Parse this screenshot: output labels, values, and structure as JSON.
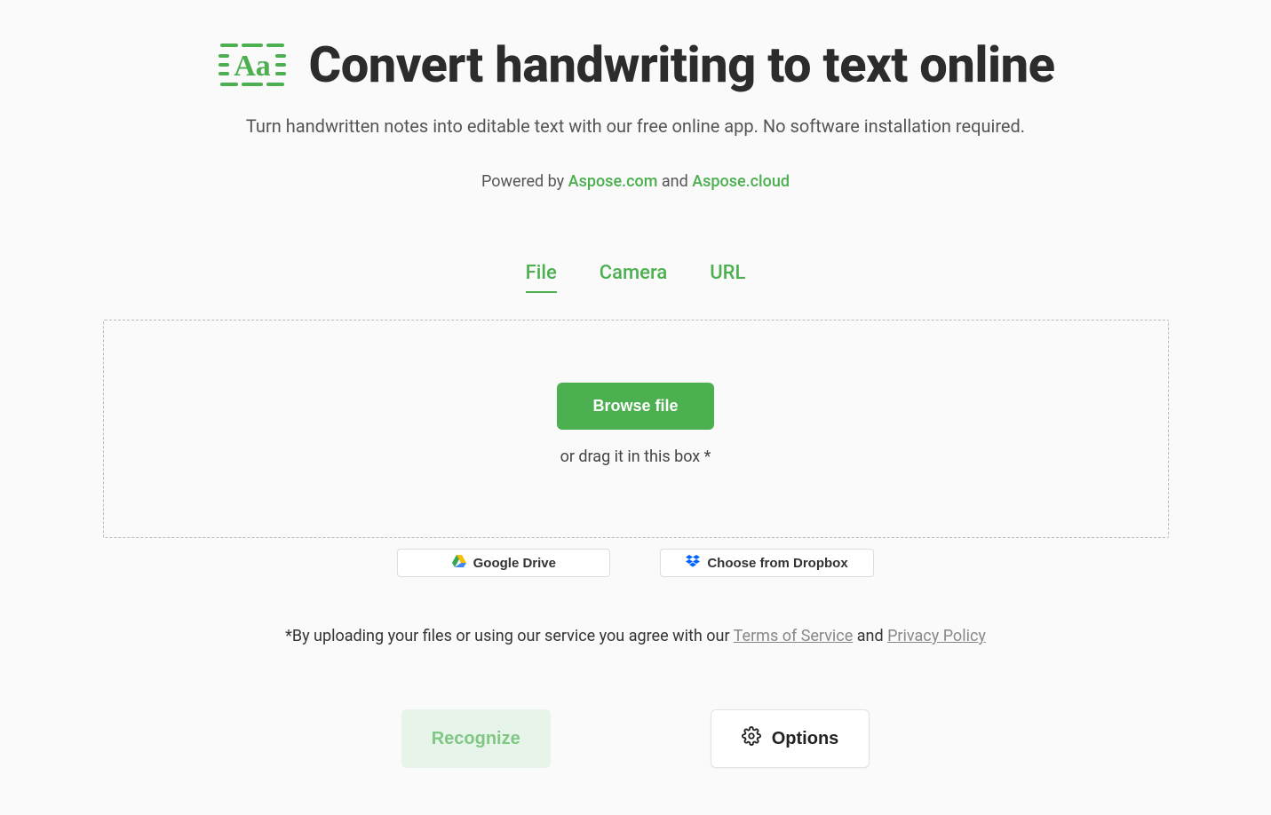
{
  "header": {
    "title": "Convert handwriting to text online",
    "subtitle": "Turn handwritten notes into editable text with our free online app. No software installation required.",
    "powered_prefix": "Powered by ",
    "powered_link1": "Aspose.com",
    "powered_and": " and ",
    "powered_link2": "Aspose.cloud"
  },
  "tabs": {
    "file": "File",
    "camera": "Camera",
    "url": "URL"
  },
  "dropzone": {
    "browse": "Browse file",
    "drag": "or drag it in this box *"
  },
  "cloud": {
    "google": "Google Drive",
    "dropbox": "Choose from Dropbox"
  },
  "terms": {
    "prefix": "*By uploading your files or using our service you agree with our ",
    "tos": "Terms of Service",
    "and": " and ",
    "privacy": "Privacy Policy"
  },
  "actions": {
    "recognize": "Recognize",
    "options": "Options"
  }
}
